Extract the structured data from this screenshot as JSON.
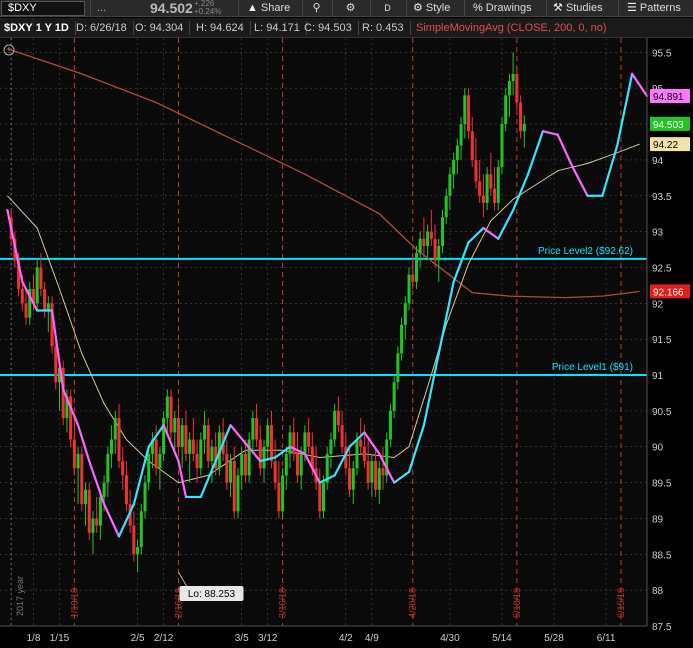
{
  "toolbar": {
    "symbol": "$DXY",
    "menu_dots": "...",
    "last_price": "94.502",
    "change_abs": "+.226",
    "change_pct": "+0.24%",
    "share_label": "Share",
    "style_label": "Style",
    "drawings_label": "Drawings",
    "studies_label": "Studies",
    "patterns_label": "Patterns",
    "d_label": "D"
  },
  "infobar": {
    "title": "$DXY 1 Y 1D",
    "date": "D: 6/26/18",
    "open": "O: 94.304",
    "high": "H: 94.624",
    "low": "L: 94.171",
    "close": "C: 94.503",
    "range": "R: 0.453",
    "study": "SimpleMovingAvg (CLOSE, 200, 0, no)"
  },
  "chart_data": {
    "type": "candlestick",
    "ylim": [
      87.5,
      95.7
    ],
    "y_ticks": [
      "95.5",
      "95",
      "94.5",
      "94",
      "93.5",
      "93",
      "92.5",
      "92",
      "91.5",
      "91",
      "90.5",
      "90",
      "89.5",
      "89",
      "88.5",
      "88",
      "87.5"
    ],
    "x_ticks": [
      "1/8",
      "1/15",
      "2/5",
      "2/12",
      "3/5",
      "3/12",
      "4/2",
      "4/9",
      "4/30",
      "5/14",
      "5/28",
      "6/11"
    ],
    "x_tick_days": [
      7,
      14,
      35,
      42,
      63,
      70,
      91,
      98,
      119,
      133,
      147,
      161
    ],
    "vertical_markers": [
      {
        "day": 18,
        "label": "1/19/18"
      },
      {
        "day": 46,
        "label": "2/16/18"
      },
      {
        "day": 74,
        "label": "3/16/18"
      },
      {
        "day": 109,
        "label": "4/20/18"
      },
      {
        "day": 137,
        "label": "5/18/18"
      },
      {
        "day": 165,
        "label": "6/15/18"
      }
    ],
    "year_label": "2017 year",
    "horizontal_levels": [
      {
        "label": "Price Level2 ($92.62)",
        "value": 92.62,
        "color": "#00e5ff"
      },
      {
        "label": "Price Level1 ($91)",
        "value": 91.0,
        "color": "#00e5ff"
      }
    ],
    "low_callout": {
      "label": "Lo: 88.253",
      "day": 46,
      "value": 88.253
    },
    "price_labels": [
      {
        "value": 94.891,
        "text": "94.891",
        "bg": "#ff77ff",
        "fg": "#000"
      },
      {
        "value": 94.503,
        "text": "94.503",
        "bg": "#22c522",
        "fg": "#fff"
      },
      {
        "value": 94.22,
        "text": "94.22",
        "bg": "#f3e2a9",
        "fg": "#000"
      },
      {
        "value": 92.166,
        "text": "92.166",
        "bg": "#e02020",
        "fg": "#fff"
      }
    ],
    "colors": {
      "up": "#22c522",
      "down": "#ee3333",
      "sma200": "#b04a3a",
      "sma_slow": "#d8c89a",
      "ma_fast_up": "#33e6ff",
      "ma_fast_down": "#ff66ff",
      "grid": "#4a4a4a",
      "marker": "#c0392b"
    },
    "series": [
      {
        "name": "SimpleMovingAvg (CLOSE, 200, 0, no)",
        "values": [
          [
            0,
            95.55
          ],
          [
            20,
            95.2
          ],
          [
            40,
            94.8
          ],
          [
            60,
            94.3
          ],
          [
            80,
            93.8
          ],
          [
            100,
            93.25
          ],
          [
            110,
            92.75
          ],
          [
            120,
            92.35
          ],
          [
            125,
            92.15
          ],
          [
            135,
            92.1
          ],
          [
            150,
            92.08
          ],
          [
            160,
            92.1
          ],
          [
            170,
            92.166
          ]
        ]
      },
      {
        "name": "slow",
        "values": [
          [
            0,
            93.5
          ],
          [
            8,
            93.05
          ],
          [
            14,
            92.2
          ],
          [
            20,
            91.3
          ],
          [
            26,
            90.6
          ],
          [
            32,
            90.1
          ],
          [
            38,
            89.8
          ],
          [
            46,
            89.5
          ],
          [
            54,
            89.6
          ],
          [
            64,
            89.95
          ],
          [
            74,
            89.95
          ],
          [
            84,
            89.85
          ],
          [
            96,
            89.9
          ],
          [
            104,
            89.85
          ],
          [
            108,
            90.0
          ],
          [
            114,
            91.0
          ],
          [
            118,
            91.7
          ],
          [
            124,
            92.55
          ],
          [
            130,
            93.15
          ],
          [
            136,
            93.45
          ],
          [
            142,
            93.65
          ],
          [
            148,
            93.85
          ],
          [
            156,
            93.95
          ],
          [
            164,
            94.1
          ],
          [
            170,
            94.22
          ]
        ]
      },
      {
        "name": "fast",
        "values": [
          [
            0,
            93.3
          ],
          [
            4,
            92.3
          ],
          [
            8,
            91.9
          ],
          [
            12,
            91.9
          ],
          [
            15,
            90.8
          ],
          [
            19,
            90.3
          ],
          [
            22,
            89.8
          ],
          [
            26,
            89.2
          ],
          [
            30,
            88.75
          ],
          [
            34,
            89.2
          ],
          [
            38,
            90.0
          ],
          [
            42,
            90.3
          ],
          [
            46,
            89.8
          ],
          [
            48,
            89.3
          ],
          [
            52,
            89.3
          ],
          [
            56,
            89.8
          ],
          [
            60,
            90.3
          ],
          [
            64,
            90.05
          ],
          [
            68,
            89.8
          ],
          [
            72,
            89.85
          ],
          [
            76,
            90.0
          ],
          [
            80,
            89.9
          ],
          [
            84,
            89.5
          ],
          [
            88,
            89.6
          ],
          [
            92,
            90.0
          ],
          [
            96,
            90.2
          ],
          [
            100,
            89.9
          ],
          [
            104,
            89.5
          ],
          [
            108,
            89.65
          ],
          [
            112,
            90.3
          ],
          [
            116,
            91.3
          ],
          [
            120,
            92.3
          ],
          [
            124,
            92.85
          ],
          [
            128,
            93.05
          ],
          [
            132,
            92.9
          ],
          [
            136,
            93.3
          ],
          [
            140,
            93.8
          ],
          [
            144,
            94.4
          ],
          [
            148,
            94.35
          ],
          [
            152,
            93.9
          ],
          [
            156,
            93.5
          ],
          [
            160,
            93.5
          ],
          [
            164,
            94.2
          ],
          [
            168,
            95.2
          ],
          [
            172,
            94.891
          ]
        ]
      }
    ],
    "candles": [
      [
        1,
        93.2,
        93.3,
        92.8,
        92.9
      ],
      [
        2,
        92.9,
        93.0,
        92.5,
        92.6
      ],
      [
        3,
        92.6,
        92.7,
        92.1,
        92.2
      ],
      [
        4,
        92.2,
        92.4,
        91.9,
        92.0
      ],
      [
        5,
        92.0,
        92.2,
        91.7,
        91.8
      ],
      [
        6,
        91.8,
        92.3,
        91.7,
        92.2
      ],
      [
        7,
        92.2,
        92.4,
        91.9,
        92.0
      ],
      [
        8,
        92.0,
        92.6,
        91.9,
        92.5
      ],
      [
        9,
        92.5,
        92.7,
        92.1,
        92.2
      ],
      [
        10,
        92.2,
        92.3,
        91.8,
        91.9
      ],
      [
        11,
        91.9,
        92.1,
        91.6,
        92.0
      ],
      [
        12,
        92.0,
        92.1,
        91.3,
        91.4
      ],
      [
        13,
        91.4,
        91.5,
        90.8,
        90.9
      ],
      [
        14,
        90.9,
        91.2,
        90.5,
        91.1
      ],
      [
        15,
        91.1,
        91.2,
        90.3,
        90.4
      ],
      [
        16,
        90.4,
        90.8,
        90.2,
        90.7
      ],
      [
        17,
        90.7,
        90.8,
        90.0,
        90.1
      ],
      [
        18,
        90.1,
        90.4,
        89.6,
        89.7
      ],
      [
        19,
        89.7,
        90.0,
        89.2,
        89.9
      ],
      [
        20,
        89.9,
        90.0,
        89.1,
        89.2
      ],
      [
        21,
        89.2,
        89.5,
        88.9,
        89.4
      ],
      [
        22,
        89.4,
        89.5,
        88.7,
        88.8
      ],
      [
        23,
        88.8,
        89.1,
        88.5,
        89.0
      ],
      [
        24,
        89.0,
        89.3,
        88.8,
        88.9
      ],
      [
        25,
        88.9,
        89.4,
        88.7,
        89.3
      ],
      [
        26,
        89.3,
        89.6,
        89.1,
        89.5
      ],
      [
        27,
        89.5,
        90.0,
        89.3,
        89.9
      ],
      [
        28,
        89.9,
        90.3,
        89.7,
        90.1
      ],
      [
        29,
        90.1,
        90.5,
        89.9,
        90.4
      ],
      [
        30,
        90.4,
        90.6,
        89.7,
        89.8
      ],
      [
        31,
        89.8,
        90.0,
        89.4,
        89.6
      ],
      [
        32,
        89.6,
        89.8,
        89.1,
        89.2
      ],
      [
        33,
        89.2,
        89.4,
        88.8,
        88.9
      ],
      [
        34,
        88.9,
        89.1,
        88.4,
        88.5
      ],
      [
        35,
        88.5,
        88.7,
        88.25,
        88.6
      ],
      [
        36,
        88.6,
        89.2,
        88.5,
        89.1
      ],
      [
        37,
        89.1,
        89.6,
        89.0,
        89.5
      ],
      [
        38,
        89.5,
        90.0,
        89.4,
        89.9
      ],
      [
        39,
        89.9,
        90.2,
        89.7,
        90.1
      ],
      [
        40,
        90.1,
        90.3,
        89.6,
        89.7
      ],
      [
        41,
        89.7,
        90.0,
        89.4,
        89.9
      ],
      [
        42,
        89.9,
        90.5,
        89.8,
        90.4
      ],
      [
        43,
        90.4,
        90.8,
        90.2,
        90.7
      ],
      [
        44,
        90.7,
        90.8,
        90.1,
        90.2
      ],
      [
        45,
        90.2,
        90.5,
        89.9,
        90.4
      ],
      [
        46,
        90.4,
        90.6,
        89.9,
        90.0
      ],
      [
        47,
        90.0,
        90.4,
        89.7,
        90.3
      ],
      [
        48,
        90.3,
        90.5,
        89.8,
        89.9
      ],
      [
        49,
        89.9,
        90.2,
        89.5,
        90.1
      ],
      [
        50,
        90.1,
        90.4,
        89.8,
        89.9
      ],
      [
        51,
        89.9,
        90.1,
        89.5,
        89.7
      ],
      [
        52,
        89.7,
        90.2,
        89.6,
        90.1
      ],
      [
        53,
        90.1,
        90.5,
        89.9,
        90.3
      ],
      [
        54,
        90.3,
        90.4,
        89.7,
        89.8
      ],
      [
        55,
        89.8,
        90.1,
        89.5,
        90.0
      ],
      [
        56,
        90.0,
        90.2,
        89.6,
        89.7
      ],
      [
        57,
        89.7,
        90.3,
        89.6,
        90.2
      ],
      [
        58,
        90.2,
        90.4,
        89.8,
        89.9
      ],
      [
        59,
        89.9,
        90.1,
        89.4,
        89.5
      ],
      [
        60,
        89.5,
        89.9,
        89.3,
        89.8
      ],
      [
        61,
        89.8,
        90.0,
        89.0,
        89.1
      ],
      [
        62,
        89.1,
        89.7,
        89.0,
        89.6
      ],
      [
        63,
        89.6,
        90.0,
        89.4,
        89.9
      ],
      [
        64,
        89.9,
        90.1,
        89.5,
        89.6
      ],
      [
        65,
        89.6,
        90.2,
        89.5,
        90.1
      ],
      [
        66,
        90.1,
        90.5,
        89.9,
        90.4
      ],
      [
        67,
        90.4,
        90.6,
        90.0,
        90.1
      ],
      [
        68,
        90.1,
        90.3,
        89.6,
        89.7
      ],
      [
        69,
        89.7,
        90.1,
        89.5,
        90.0
      ],
      [
        70,
        90.0,
        90.4,
        89.8,
        90.3
      ],
      [
        71,
        90.3,
        90.5,
        89.7,
        89.8
      ],
      [
        72,
        89.8,
        90.1,
        89.4,
        89.5
      ],
      [
        73,
        89.5,
        89.8,
        89.0,
        89.1
      ],
      [
        74,
        89.1,
        89.7,
        89.0,
        89.6
      ],
      [
        75,
        89.6,
        90.0,
        89.4,
        89.9
      ],
      [
        76,
        89.9,
        90.3,
        89.7,
        90.2
      ],
      [
        77,
        90.2,
        90.4,
        89.8,
        89.9
      ],
      [
        78,
        89.9,
        90.2,
        89.5,
        89.6
      ],
      [
        79,
        89.6,
        90.0,
        89.4,
        89.9
      ],
      [
        80,
        89.9,
        90.3,
        89.8,
        90.2
      ],
      [
        81,
        90.2,
        90.4,
        89.9,
        90.0
      ],
      [
        82,
        90.0,
        90.2,
        89.6,
        89.7
      ],
      [
        83,
        89.7,
        90.0,
        89.4,
        89.5
      ],
      [
        84,
        89.5,
        89.7,
        89.0,
        89.1
      ],
      [
        85,
        89.1,
        89.6,
        89.0,
        89.5
      ],
      [
        86,
        89.5,
        90.0,
        89.4,
        89.9
      ],
      [
        87,
        89.9,
        90.2,
        89.7,
        90.1
      ],
      [
        88,
        90.1,
        90.6,
        90.0,
        90.5
      ],
      [
        89,
        90.5,
        90.7,
        90.2,
        90.3
      ],
      [
        90,
        90.3,
        90.5,
        89.9,
        90.0
      ],
      [
        91,
        90.0,
        90.2,
        89.6,
        89.7
      ],
      [
        92,
        89.7,
        90.0,
        89.3,
        89.4
      ],
      [
        93,
        89.4,
        89.8,
        89.2,
        89.7
      ],
      [
        94,
        89.7,
        90.2,
        89.6,
        90.1
      ],
      [
        95,
        90.1,
        90.4,
        89.9,
        90.0
      ],
      [
        96,
        90.0,
        90.3,
        89.7,
        89.8
      ],
      [
        97,
        89.8,
        90.1,
        89.4,
        89.5
      ],
      [
        98,
        89.5,
        89.9,
        89.3,
        89.8
      ],
      [
        99,
        89.8,
        90.0,
        89.3,
        89.4
      ],
      [
        100,
        89.4,
        89.8,
        89.2,
        89.7
      ],
      [
        101,
        89.7,
        90.0,
        89.4,
        89.6
      ],
      [
        102,
        89.6,
        90.2,
        89.5,
        90.1
      ],
      [
        103,
        90.1,
        90.6,
        90.0,
        90.5
      ],
      [
        104,
        90.5,
        91.0,
        90.4,
        90.9
      ],
      [
        105,
        90.9,
        91.4,
        90.8,
        91.3
      ],
      [
        106,
        91.3,
        91.8,
        91.2,
        91.7
      ],
      [
        107,
        91.7,
        92.1,
        91.5,
        92.0
      ],
      [
        108,
        92.0,
        92.5,
        91.9,
        92.4
      ],
      [
        109,
        92.4,
        92.7,
        92.2,
        92.3
      ],
      [
        110,
        92.3,
        92.8,
        92.2,
        92.7
      ],
      [
        111,
        92.7,
        93.0,
        92.5,
        92.9
      ],
      [
        112,
        92.9,
        93.2,
        92.6,
        92.8
      ],
      [
        113,
        92.8,
        93.1,
        92.6,
        93.0
      ],
      [
        114,
        93.0,
        93.3,
        92.8,
        92.9
      ],
      [
        115,
        92.9,
        93.1,
        92.5,
        92.6
      ],
      [
        116,
        92.6,
        92.9,
        92.3,
        92.8
      ],
      [
        117,
        92.8,
        93.3,
        92.7,
        93.2
      ],
      [
        118,
        93.2,
        93.6,
        93.1,
        93.5
      ],
      [
        119,
        93.5,
        93.9,
        93.3,
        93.8
      ],
      [
        120,
        93.8,
        94.1,
        93.6,
        94.0
      ],
      [
        121,
        94.0,
        94.3,
        93.8,
        94.2
      ],
      [
        122,
        94.2,
        94.6,
        94.0,
        94.5
      ],
      [
        123,
        94.5,
        95.0,
        94.3,
        94.9
      ],
      [
        124,
        94.9,
        95.0,
        94.3,
        94.4
      ],
      [
        125,
        94.4,
        94.6,
        93.9,
        94.0
      ],
      [
        126,
        94.0,
        94.3,
        93.6,
        93.7
      ],
      [
        127,
        93.7,
        94.0,
        93.4,
        93.5
      ],
      [
        128,
        93.5,
        93.8,
        93.2,
        93.4
      ],
      [
        129,
        93.4,
        93.9,
        93.3,
        93.8
      ],
      [
        130,
        93.8,
        94.1,
        93.5,
        93.6
      ],
      [
        131,
        93.6,
        93.9,
        93.3,
        93.4
      ],
      [
        132,
        93.4,
        94.0,
        93.3,
        93.9
      ],
      [
        133,
        93.9,
        94.6,
        93.8,
        94.5
      ],
      [
        134,
        94.5,
        95.0,
        94.4,
        94.9
      ],
      [
        135,
        94.9,
        95.2,
        94.6,
        95.1
      ],
      [
        136,
        95.1,
        95.5,
        94.9,
        95.2
      ],
      [
        137,
        95.2,
        95.3,
        94.7,
        94.8
      ],
      [
        138,
        94.8,
        94.9,
        94.3,
        94.4
      ],
      [
        139,
        94.4,
        94.624,
        94.171,
        94.503
      ]
    ]
  }
}
